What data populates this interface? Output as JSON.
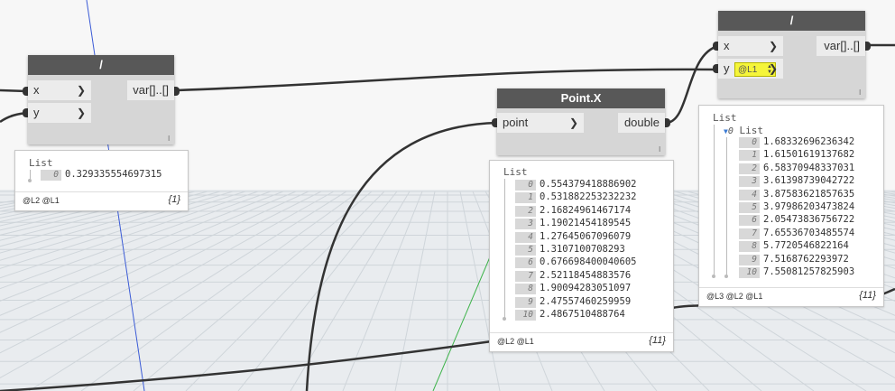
{
  "colors": {
    "node_header": "#585858",
    "node_body": "#d6d6d6",
    "port_bg": "#ececec",
    "use_levels_highlight": "#f5f53a"
  },
  "nodes": {
    "divide_left": {
      "title": "/",
      "inputs": [
        {
          "name": "x"
        },
        {
          "name": "y"
        }
      ],
      "output": "var[]..[]",
      "lacing": "l",
      "preview": {
        "title": "List",
        "items": [
          {
            "index": "0",
            "value": "0.329335554697315"
          }
        ],
        "levels": "@L2 @L1",
        "count": "{1}"
      }
    },
    "point_x": {
      "title": "Point.X",
      "inputs": [
        {
          "name": "point"
        }
      ],
      "output": "double",
      "lacing": "l",
      "preview": {
        "title": "List",
        "items": [
          {
            "index": "0",
            "value": "0.554379418886902"
          },
          {
            "index": "1",
            "value": "0.531882253232232"
          },
          {
            "index": "2",
            "value": "2.16824961467174"
          },
          {
            "index": "3",
            "value": "1.19021454189545"
          },
          {
            "index": "4",
            "value": "1.27645067096079"
          },
          {
            "index": "5",
            "value": "1.3107100708293"
          },
          {
            "index": "6",
            "value": "0.676698400040605"
          },
          {
            "index": "7",
            "value": "2.52118454883576"
          },
          {
            "index": "8",
            "value": "1.90094283051097"
          },
          {
            "index": "9",
            "value": "2.47557460259959"
          },
          {
            "index": "10",
            "value": "2.4867510488764"
          }
        ],
        "levels": "@L2 @L1",
        "count": "{11}"
      }
    },
    "divide_right": {
      "title": "/",
      "inputs": [
        {
          "name": "x"
        },
        {
          "name": "y",
          "use_level": "@L1"
        }
      ],
      "output": "var[]..[]",
      "lacing": "l",
      "preview": {
        "title": "List",
        "sublist_index": "0",
        "sublist_title": "List",
        "items": [
          {
            "index": "0",
            "value": "1.68332696236342"
          },
          {
            "index": "1",
            "value": "1.61501619137682"
          },
          {
            "index": "2",
            "value": "6.58370948337031"
          },
          {
            "index": "3",
            "value": "3.61398739042722"
          },
          {
            "index": "4",
            "value": "3.87583621857635"
          },
          {
            "index": "5",
            "value": "3.97986203473824"
          },
          {
            "index": "6",
            "value": "2.05473836756722"
          },
          {
            "index": "7",
            "value": "7.65536703485574"
          },
          {
            "index": "8",
            "value": "5.7720546822164"
          },
          {
            "index": "9",
            "value": "7.5168762293972"
          },
          {
            "index": "10",
            "value": "7.55081257825903"
          }
        ],
        "levels": "@L3 @L2 @L1",
        "count": "{11}"
      }
    }
  }
}
